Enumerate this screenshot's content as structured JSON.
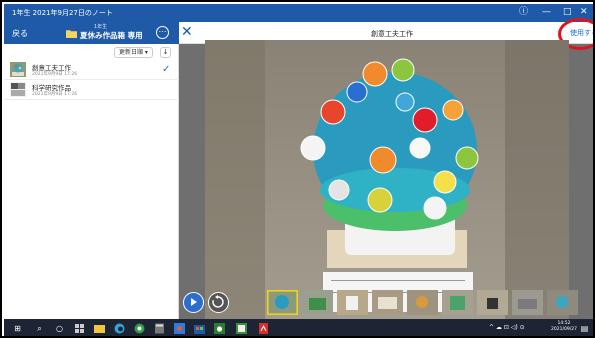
{
  "window": {
    "title": "1年生 2021年9月27日のノート",
    "controls": {
      "info": "ⓘ",
      "minimize": "—",
      "maximize": "□",
      "close": "✕"
    }
  },
  "sidebar": {
    "back_label": "戻る",
    "folder_subtitle": "1年生",
    "folder_title": "夏休み作品箱 専用",
    "more_icon": "⋯",
    "sort_label": "更新日順 ▾",
    "sort_dir_icon": "↓",
    "items": [
      {
        "name": "創意工夫工作",
        "date": "2021年9月9日 17:26",
        "selected": true,
        "check": "✓"
      },
      {
        "name": "科学研究作品",
        "date": "2021年9月9日 17:26",
        "selected": false,
        "check": ""
      }
    ]
  },
  "viewer": {
    "close_icon": "✕",
    "title": "創意工夫工作",
    "use_button": "使用する",
    "play_icon": "▶",
    "replay_icon": "↺",
    "thumbnail_count": 9,
    "selected_thumbnail": 1
  },
  "taskbar": {
    "start_icon": "⊞",
    "search_icon": "⌕",
    "taskview_icon": "○",
    "clock_time": "14:52",
    "clock_date": "2021/09/27",
    "tray_icons": "^ ☁ ⊡ ◁) ⊙",
    "notification_icon": "▤"
  },
  "colors": {
    "accent": "#1e5aa8",
    "highlight_circle": "#e0141e",
    "selected_thumb_border": "#f2d11b"
  }
}
